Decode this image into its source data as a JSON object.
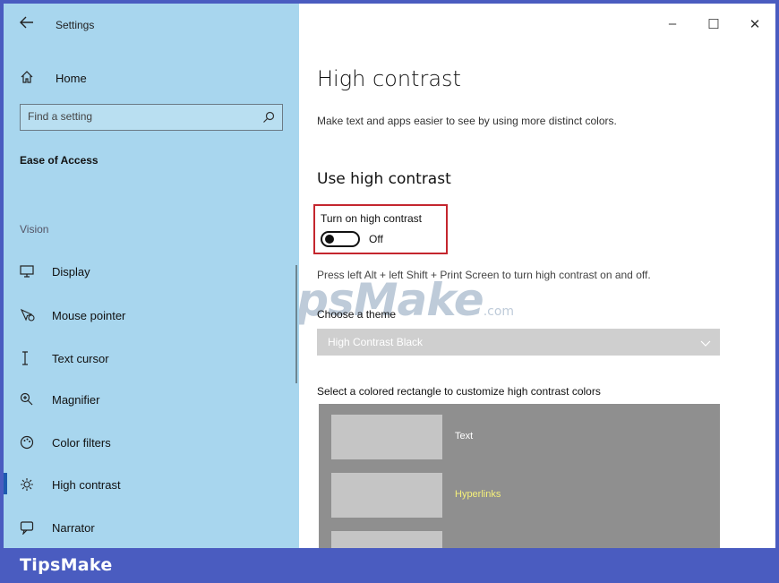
{
  "window": {
    "app_title": "Settings",
    "controls": {
      "minimize": "–",
      "maximize": "☐",
      "close": "✕"
    }
  },
  "sidebar": {
    "home_label": "Home",
    "search": {
      "placeholder": "Find a setting",
      "value": ""
    },
    "category": "Ease of Access",
    "group_label": "Vision",
    "items": [
      {
        "label": "Display",
        "icon": "monitor-icon",
        "active": false
      },
      {
        "label": "Mouse pointer",
        "icon": "mouse-pointer-icon",
        "active": false
      },
      {
        "label": "Text cursor",
        "icon": "text-cursor-icon",
        "active": false
      },
      {
        "label": "Magnifier",
        "icon": "magnifier-icon",
        "active": false
      },
      {
        "label": "Color filters",
        "icon": "color-filters-icon",
        "active": false
      },
      {
        "label": "High contrast",
        "icon": "brightness-icon",
        "active": true
      },
      {
        "label": "Narrator",
        "icon": "narrator-icon",
        "active": false
      }
    ]
  },
  "main": {
    "title": "High contrast",
    "description": "Make text and apps easier to see by using more distinct colors.",
    "section_title": "Use high contrast",
    "toggle": {
      "label": "Turn on high contrast",
      "state": "Off"
    },
    "hint": "Press left Alt + left Shift + Print Screen to turn high contrast on and off.",
    "theme": {
      "label": "Choose a theme",
      "selected": "High Contrast Black"
    },
    "colors": {
      "label": "Select a colored rectangle to customize high contrast colors",
      "items": [
        {
          "label": "Text",
          "color": "#ffffff"
        },
        {
          "label": "Hyperlinks",
          "color": "#f5f07a"
        }
      ]
    }
  },
  "watermark": {
    "main": "TipsMake",
    "suffix": ".com"
  },
  "footer": {
    "brand": "TipsMake"
  },
  "colors": {
    "sidebar_bg": "#a8d6ee",
    "accent": "#1e5bb0",
    "frame": "#4a5cc0",
    "highlight_border": "#c4262e"
  }
}
